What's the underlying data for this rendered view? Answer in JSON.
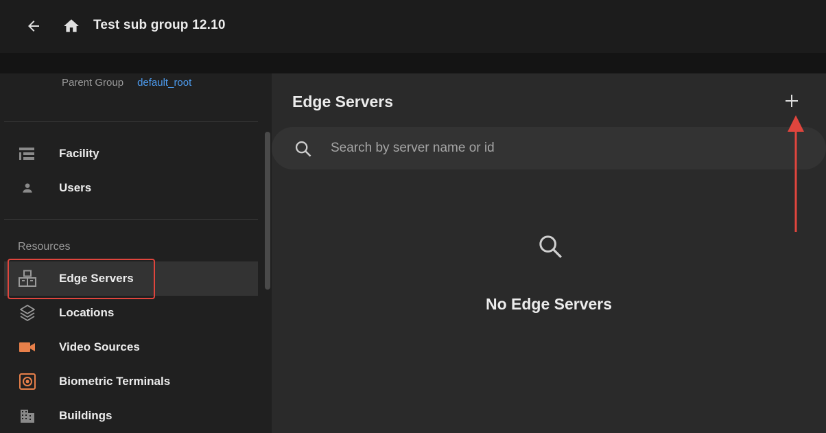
{
  "header": {
    "title": "Test sub group 12.10",
    "back_icon": "arrow-left-icon",
    "home_icon": "home-icon"
  },
  "sidebar": {
    "parent_group_label": "Parent Group",
    "parent_group_value": "default_root",
    "top_items": [
      {
        "label": "Facility",
        "icon": "facility-icon"
      },
      {
        "label": "Users",
        "icon": "user-icon"
      }
    ],
    "section_label": "Resources",
    "resource_items": [
      {
        "label": "Edge Servers",
        "icon": "edge-server-icon",
        "active": true
      },
      {
        "label": "Locations",
        "icon": "layers-icon"
      },
      {
        "label": "Video Sources",
        "icon": "video-camera-icon",
        "color": "#e8804a"
      },
      {
        "label": "Biometric Terminals",
        "icon": "biometric-terminal-icon",
        "color": "#e8804a"
      },
      {
        "label": "Buildings",
        "icon": "building-icon"
      }
    ]
  },
  "main": {
    "title": "Edge Servers",
    "add_icon": "plus-icon",
    "search": {
      "placeholder": "Search by server name or id",
      "value": ""
    },
    "empty_state": {
      "icon": "search-icon",
      "text": "No Edge Servers"
    }
  },
  "colors": {
    "accent_link": "#4d9cf0",
    "annotation_red": "#e0453d",
    "orange_icon": "#e8804a"
  }
}
